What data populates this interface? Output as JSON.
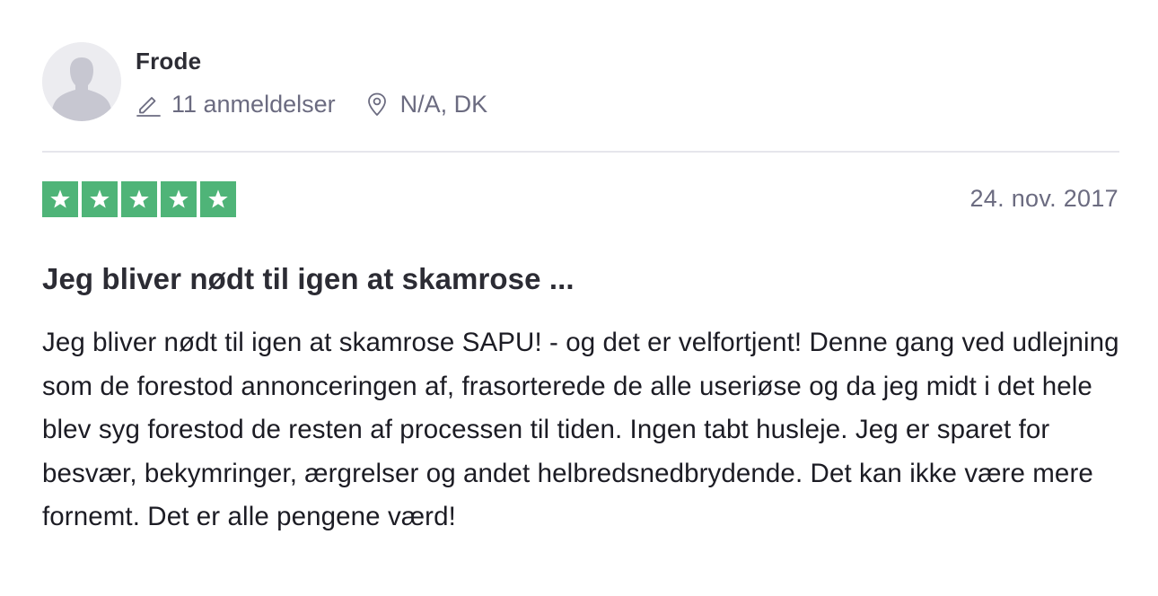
{
  "reviewer": {
    "name": "Frode",
    "avatar_icon": "user-silhouette-icon",
    "review_count_icon": "pencil-icon",
    "review_count": "11 anmeldelser",
    "location_icon": "location-pin-icon",
    "location": "N/A, DK"
  },
  "review": {
    "rating": 5,
    "rating_max": 5,
    "star_color": "#4fb478",
    "date": "24. nov. 2017",
    "title": "Jeg bliver nødt til igen at skamrose ...",
    "body": "Jeg bliver nødt til igen at skamrose SAPU! - og det er velfortjent! Denne gang ved udlejning som de forestod annonceringen af, frasorterede de alle useriøse og da jeg midt i det hele blev syg forestod de resten af processen til tiden. Ingen tabt husleje. Jeg er sparet for besvær, bekymringer, ærgrelser og andet helbredsnedbrydende. Det kan ikke være mere fornemt. Det er alle pengene værd!"
  }
}
